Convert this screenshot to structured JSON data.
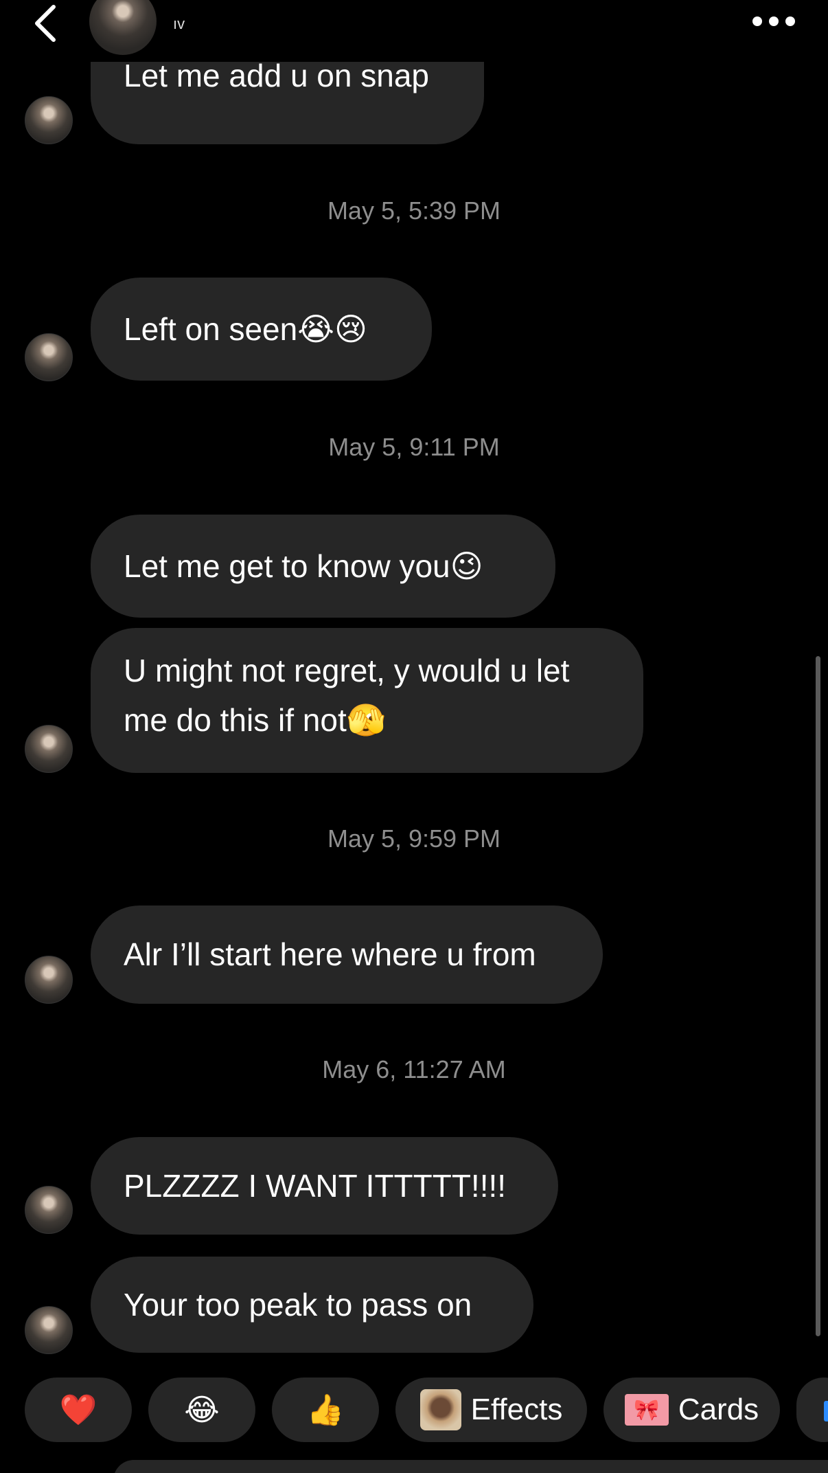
{
  "header": {
    "contact_name": "ıv",
    "back_icon": "chevron-left-icon",
    "more_icon": "more-horizontal-icon"
  },
  "messages": [
    {
      "text": "Let me add u on snap"
    },
    {
      "timestamp": "May 5, 5:39 PM"
    },
    {
      "text": "Left on seen😭😢"
    },
    {
      "timestamp": "May 5, 9:11 PM"
    },
    {
      "text": "Let me get to know you😉"
    },
    {
      "text": "U might not regret, y would u let me do this if not🫣"
    },
    {
      "timestamp": "May 5, 9:59 PM"
    },
    {
      "text": "Alr I’ll start here where u from"
    },
    {
      "timestamp": "May 6, 11:27 AM"
    },
    {
      "text": "PLZZZZ I WANT ITTTTT!!!!"
    },
    {
      "text": "Your too peak to pass on"
    }
  ],
  "quick_actions": {
    "heart": "❤️",
    "laugh": "😂",
    "thumbs_up": "👍",
    "effects_label": "Effects",
    "cards_label": "Cards",
    "cards_icon": "bow-icon"
  },
  "colors": {
    "background": "#000000",
    "bubble": "#262626",
    "timestamp": "#8e8e8e"
  }
}
